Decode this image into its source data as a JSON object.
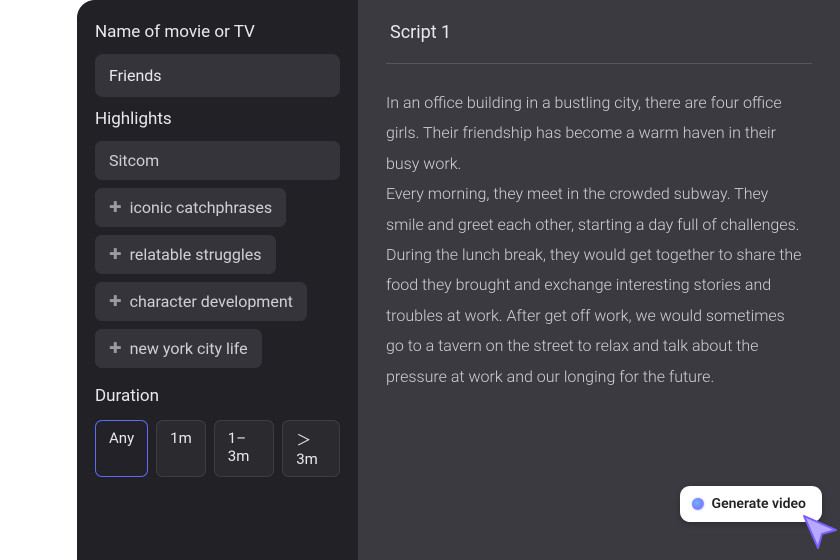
{
  "sidebar": {
    "name_label": "Name of movie or TV",
    "name_value": "Friends",
    "highlights_label": "Highlights",
    "highlight_primary": "Sitcom",
    "highlight_suggestions": [
      "iconic catchphrases",
      "relatable struggles",
      "character development",
      "new york city life"
    ],
    "duration_label": "Duration",
    "duration_options": [
      "Any",
      "1m",
      "1–3m",
      "＞3m"
    ],
    "duration_selected_index": 0
  },
  "main": {
    "script_title": "Script 1",
    "script_body": "In an office building in a bustling city, there are four office girls. Their friendship has become a warm haven in their busy work.\nEvery morning, they meet in the crowded subway. They smile and greet each other, starting a day full of challenges. During the lunch break, they would get together to share the food they brought and exchange interesting stories and troubles at work. After get off work, we would sometimes go to a tavern on the street to relax and talk about the pressure at work and our longing for the future."
  },
  "generate_button_label": "Generate video"
}
